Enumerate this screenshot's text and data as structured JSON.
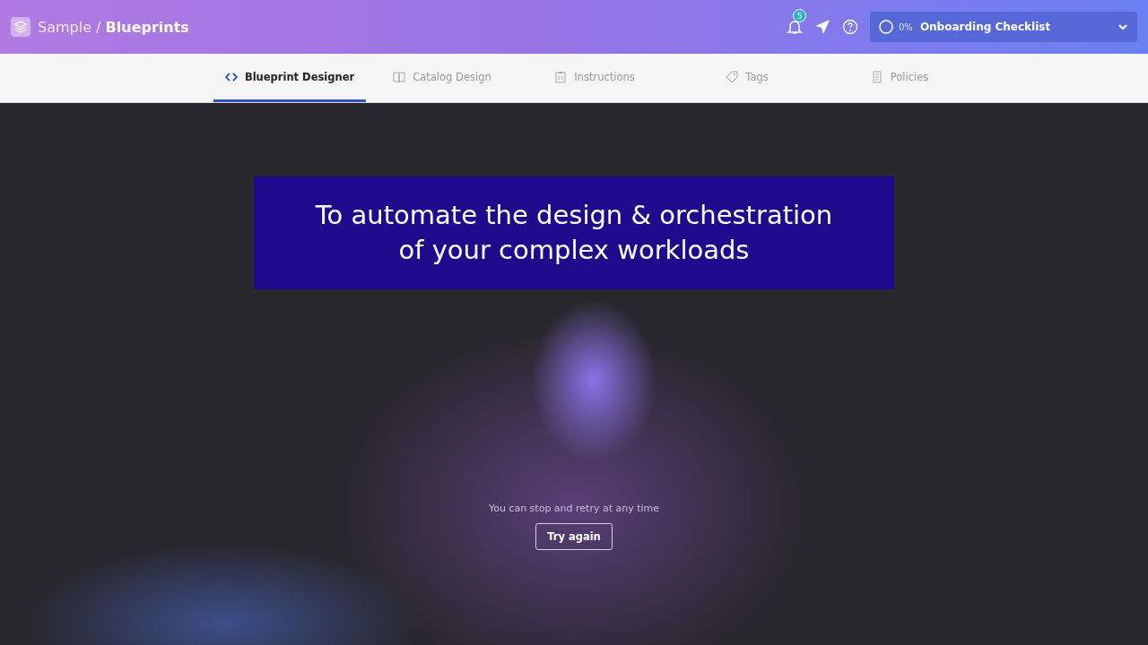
{
  "header": {
    "breadcrumb_parent": "Sample /",
    "breadcrumb_current": "Blueprints",
    "notification_count": "5",
    "checklist": {
      "percent": "0%",
      "label": "Onboarding Checklist",
      "expanded": false
    }
  },
  "tabs": [
    {
      "label": "Blueprint Designer",
      "selected": true
    },
    {
      "label": "Catalog Design",
      "selected": false
    },
    {
      "label": "Instructions",
      "selected": false
    },
    {
      "label": "Tags",
      "selected": false
    },
    {
      "label": "Policies",
      "selected": false
    }
  ],
  "caption": "To automate the design & orchestration\nof your complex workloads",
  "message": "You can stop and retry at any time",
  "retry_button": "Try again"
}
